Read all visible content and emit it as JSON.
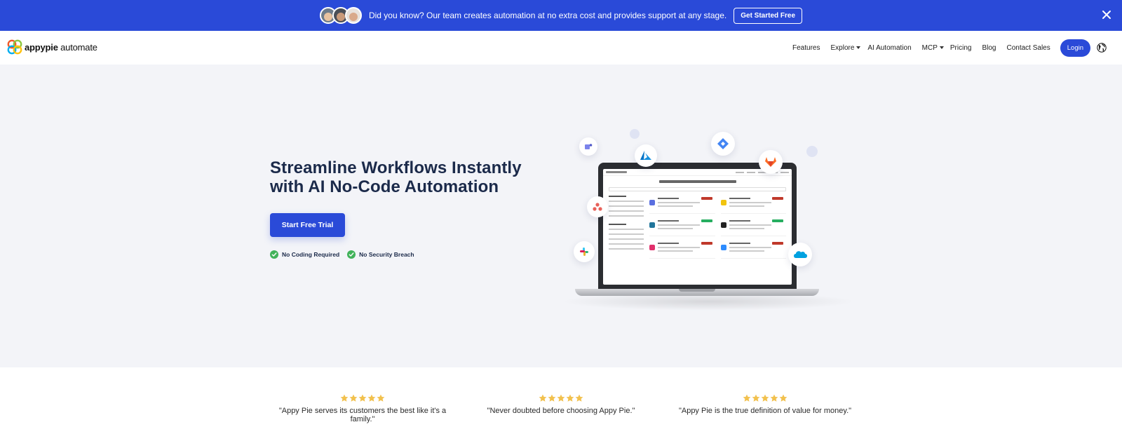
{
  "banner": {
    "message": "Did you know? Our team creates automation at no extra cost and provides support at any stage.",
    "cta_label": "Get Started Free",
    "background_color": "#2a4ad8"
  },
  "header": {
    "logo_brand": "appypie",
    "logo_product": "automate",
    "nav": {
      "features": "Features",
      "explore": "Explore",
      "ai_automation": "AI Automation",
      "mcp": "MCP",
      "pricing": "Pricing",
      "blog": "Blog",
      "contact_sales": "Contact Sales"
    },
    "login_label": "Login"
  },
  "hero": {
    "title_line1": "Streamline Workflows Instantly",
    "title_line2": "with AI No-Code Automation",
    "cta_label": "Start Free Trial",
    "check1": "No Coding Required",
    "check2": "No Security Breach",
    "accent_color": "#2a4ad8",
    "check_color": "#41b25a"
  },
  "testimonials": [
    {
      "rating": 5,
      "quote": "\"Appy Pie serves its customers the best like it's a family.\""
    },
    {
      "rating": 5,
      "quote": "\"Never doubted before choosing Appy Pie.\""
    },
    {
      "rating": 5,
      "quote": "\"Appy Pie is the true definition of value for money.\""
    }
  ],
  "icons": {
    "banner_close": "close-icon",
    "globe": "globe-icon",
    "check": "check-circle-icon",
    "star": "star-icon",
    "floating": [
      "teams-icon",
      "azure-icon",
      "diamond-icon",
      "gitlab-icon",
      "asana-icon",
      "slack-icon",
      "salesforce-icon"
    ]
  }
}
